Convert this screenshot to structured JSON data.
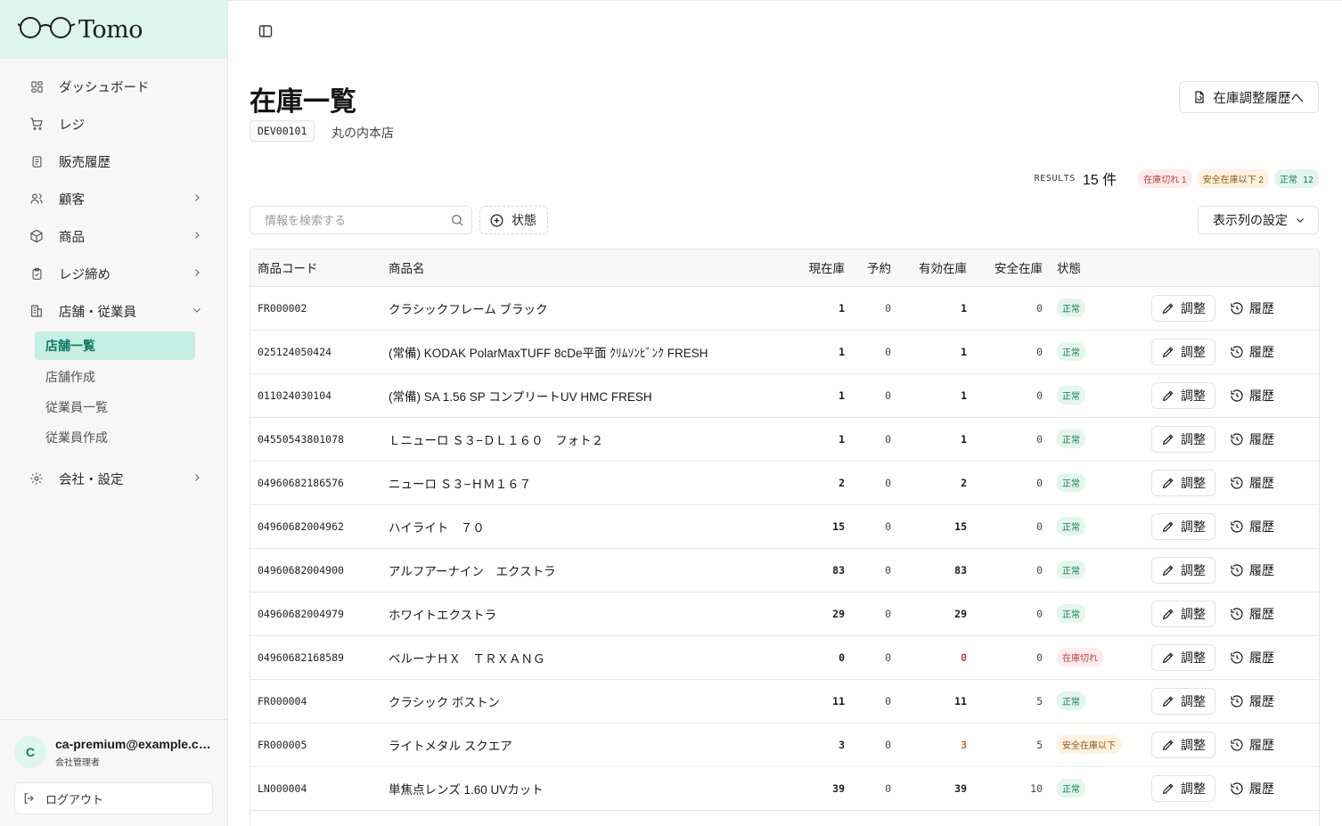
{
  "brand": {
    "name": "Tomo"
  },
  "sidebar": {
    "items": [
      {
        "label": "ダッシュボード",
        "icon": "dashboard-icon",
        "chevron": ""
      },
      {
        "label": "レジ",
        "icon": "cart-icon",
        "chevron": ""
      },
      {
        "label": "販売履歴",
        "icon": "receipt-icon",
        "chevron": ""
      },
      {
        "label": "顧客",
        "icon": "users-icon",
        "chevron": "›"
      },
      {
        "label": "商品",
        "icon": "box-icon",
        "chevron": "›"
      },
      {
        "label": "レジ締め",
        "icon": "clipboard-icon",
        "chevron": "›"
      },
      {
        "label": "店舗・従業員",
        "icon": "building-icon",
        "chevron": "⌄"
      }
    ],
    "subitems": [
      {
        "label": "店舗一覧",
        "active": true
      },
      {
        "label": "店舗作成",
        "active": false
      },
      {
        "label": "従業員一覧",
        "active": false
      },
      {
        "label": "従業員作成",
        "active": false
      }
    ],
    "settings": {
      "label": "会社・設定",
      "icon": "gear-icon",
      "chevron": "›"
    }
  },
  "user": {
    "initial": "C",
    "email": "ca-premium@example.com",
    "role": "会社管理者",
    "logout_label": "ログアウト"
  },
  "page": {
    "title": "在庫一覧",
    "store_code": "DEV00101",
    "store_name": "丸の内本店",
    "history_button": "在庫調整履歴へ"
  },
  "results": {
    "label": "RESULTS",
    "count": "15 件",
    "badges": [
      {
        "label": "在庫切れ 1",
        "tone": "red"
      },
      {
        "label": "安全在庫以下 2",
        "tone": "amber"
      },
      {
        "label": "正常 12",
        "tone": "green"
      }
    ]
  },
  "toolbar": {
    "search_placeholder": "情報を検索する",
    "status_filter": "状態",
    "column_settings": "表示列の設定"
  },
  "table": {
    "headers": {
      "code": "商品コード",
      "name": "商品名",
      "stock": "現在庫",
      "reserved": "予約",
      "available": "有効在庫",
      "safety": "安全在庫",
      "status": "状態"
    },
    "adjust_label": "調整",
    "history_label": "履歴",
    "rows": [
      {
        "code": "FR000002",
        "name": "クラシックフレーム ブラック",
        "stock": "1",
        "reserved": "0",
        "available": "1",
        "safety": "0",
        "status": "正常",
        "tone": "ok"
      },
      {
        "code": "025124050424",
        "name": "(常備) KODAK PolarMaxTUFF 8cDe平面 ｸﾘﾑｿﾝﾋﾞﾝｸ FRESH",
        "stock": "1",
        "reserved": "0",
        "available": "1",
        "safety": "0",
        "status": "正常",
        "tone": "ok"
      },
      {
        "code": "011024030104",
        "name": "(常備) SA 1.56 SP コンプリートUV HMC FRESH",
        "stock": "1",
        "reserved": "0",
        "available": "1",
        "safety": "0",
        "status": "正常",
        "tone": "ok"
      },
      {
        "code": "04550543801078",
        "name": "Ｌニューロ Ｓ３−ＤＬ１６０　フォト２",
        "stock": "1",
        "reserved": "0",
        "available": "1",
        "safety": "0",
        "status": "正常",
        "tone": "ok"
      },
      {
        "code": "04960682186576",
        "name": "ニューロ Ｓ３−ＨＭ１６７",
        "stock": "2",
        "reserved": "0",
        "available": "2",
        "safety": "0",
        "status": "正常",
        "tone": "ok"
      },
      {
        "code": "04960682004962",
        "name": "ハイライト　７０",
        "stock": "15",
        "reserved": "0",
        "available": "15",
        "safety": "0",
        "status": "正常",
        "tone": "ok"
      },
      {
        "code": "04960682004900",
        "name": "アルフアーナイン　エクストラ",
        "stock": "83",
        "reserved": "0",
        "available": "83",
        "safety": "0",
        "status": "正常",
        "tone": "ok"
      },
      {
        "code": "04960682004979",
        "name": "ホワイトエクストラ",
        "stock": "29",
        "reserved": "0",
        "available": "29",
        "safety": "0",
        "status": "正常",
        "tone": "ok"
      },
      {
        "code": "04960682168589",
        "name": "ベルーナＨＸ　ＴＲＸＡＮＧ",
        "stock": "0",
        "reserved": "0",
        "available": "0",
        "safety": "0",
        "status": "在庫切れ",
        "tone": "out"
      },
      {
        "code": "FR000004",
        "name": "クラシック ボストン",
        "stock": "11",
        "reserved": "0",
        "available": "11",
        "safety": "5",
        "status": "正常",
        "tone": "ok"
      },
      {
        "code": "FR000005",
        "name": "ライトメタル スクエア",
        "stock": "3",
        "reserved": "0",
        "available": "3",
        "safety": "5",
        "status": "安全在庫以下",
        "tone": "low"
      },
      {
        "code": "LN000004",
        "name": "単焦点レンズ 1.60 UVカット",
        "stock": "39",
        "reserved": "0",
        "available": "39",
        "safety": "10",
        "status": "正常",
        "tone": "ok"
      }
    ]
  }
}
